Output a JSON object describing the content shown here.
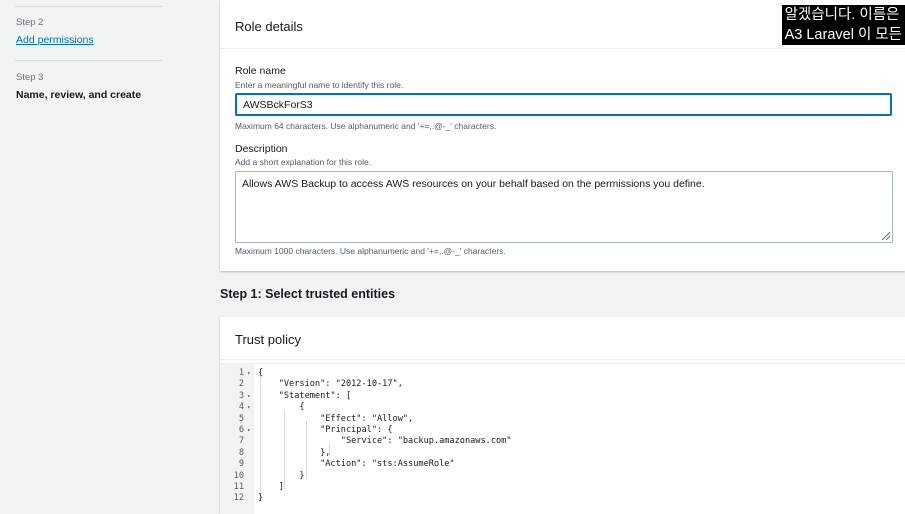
{
  "nav": {
    "step2": {
      "caption": "Step 2",
      "label": "Add permissions"
    },
    "step3": {
      "caption": "Step 3",
      "label": "Name, review, and create"
    }
  },
  "role_details": {
    "title": "Role details",
    "role_name": {
      "label": "Role name",
      "description": "Enter a meaningful name to identify this role.",
      "value": "AWSBckForS3",
      "constraint": "Maximum 64 characters. Use alphanumeric and '+=,.@-_' characters."
    },
    "description": {
      "label": "Description",
      "description": "Add a short explanation for this role.",
      "value": "Allows AWS Backup to access AWS resources on your behalf based on the permissions you define.",
      "constraint": "Maximum 1000 characters. Use alphanumeric and '+=,.@-_' characters."
    }
  },
  "step1": {
    "heading": "Step 1: Select trusted entities"
  },
  "trust_policy": {
    "title": "Trust policy",
    "lines": [
      {
        "n": "1",
        "fold": true,
        "text": "{"
      },
      {
        "n": "2",
        "fold": false,
        "text": "    \"Version\": \"2012-10-17\","
      },
      {
        "n": "3",
        "fold": true,
        "text": "    \"Statement\": ["
      },
      {
        "n": "4",
        "fold": true,
        "text": "        {"
      },
      {
        "n": "5",
        "fold": false,
        "text": "            \"Effect\": \"Allow\","
      },
      {
        "n": "6",
        "fold": true,
        "text": "            \"Principal\": {"
      },
      {
        "n": "7",
        "fold": false,
        "text": "                \"Service\": \"backup.amazonaws.com\""
      },
      {
        "n": "8",
        "fold": false,
        "text": "            },"
      },
      {
        "n": "9",
        "fold": false,
        "text": "            \"Action\": \"sts:AssumeRole\""
      },
      {
        "n": "10",
        "fold": false,
        "text": "        }"
      },
      {
        "n": "11",
        "fold": false,
        "text": "    ]"
      },
      {
        "n": "12",
        "fold": false,
        "text": "}"
      }
    ]
  },
  "caption": {
    "line1": "알겠습니다. 이름은",
    "line2": "A3 Laravel 이 모든"
  },
  "colors": {
    "accent": "#0073bb",
    "background": "#f2f3f3",
    "card": "#ffffff"
  }
}
